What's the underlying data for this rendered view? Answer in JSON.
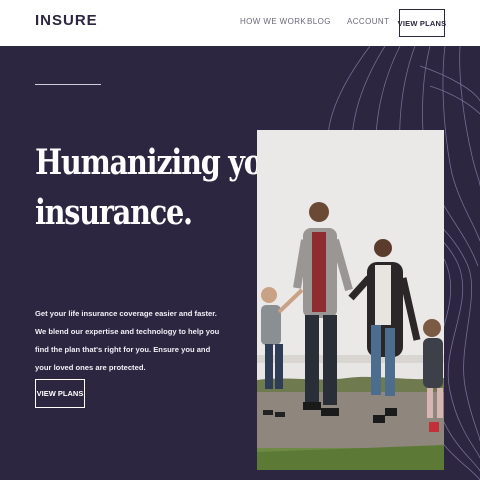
{
  "header": {
    "logo": "INSURE",
    "nav": [
      {
        "label": "HOW WE WORK"
      },
      {
        "label": "BLOG"
      },
      {
        "label": "ACCOUNT"
      }
    ],
    "cta_label": "VIEW PLANS"
  },
  "hero": {
    "headline_line1": "Humanizing your",
    "headline_line2": "insurance.",
    "description": "Get your life insurance coverage easier and faster. We blend our expertise and technology to help you find the plan that's right for you. Ensure you and your loved ones are protected.",
    "cta_label": "VIEW PLANS"
  },
  "colors": {
    "hero_background": "#2c2640",
    "header_background": "#ffffff",
    "text_light": "#ffffff"
  }
}
